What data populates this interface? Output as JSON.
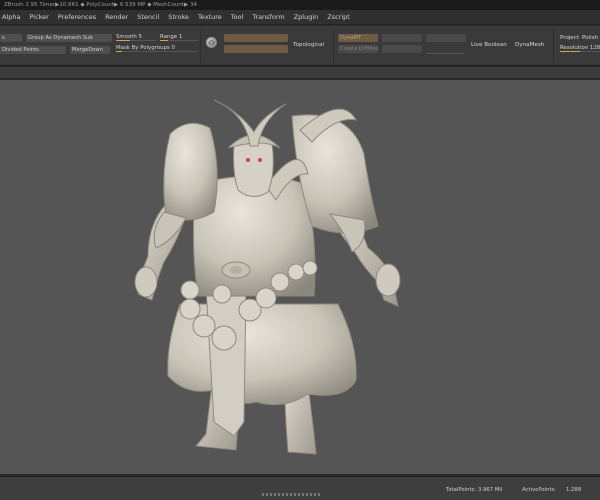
{
  "status_text": "ZBrush 2.95 Timer▶10.661 ◆ PolyCount▶ 6.539 MP ◆ MeshCount▶ 34",
  "menu": [
    "Alpha",
    "Picker",
    "Preferences",
    "Render",
    "Stencil",
    "Stroke",
    "Texture",
    "Tool",
    "Transform",
    "Zplugin",
    "Zscript"
  ],
  "palette": {
    "group_as_dynamesh_sub": "Group As Dynamesh Sub",
    "dynamesh_stub": "s",
    "divided_points": "Divided Points",
    "merge_down": "MergeDown",
    "smooth_label": "Smooth",
    "smooth_value": "5",
    "range_label": "Range",
    "range_value": "1",
    "mask_by_polygroups_label": "Mask By Polygroups",
    "mask_by_polygroups_value": "0",
    "topological": "Topological",
    "dynamat": "DynaMT",
    "create_diffmesh": "Create DiffMesh",
    "live_boolean": "Live Boolean",
    "dynamesh": "DynaMesh",
    "project": "Project",
    "polish": "Polish",
    "resolution_label": "Resolution",
    "resolution_value": "128"
  },
  "bottom": {
    "total_points_label": "TotalPoints:",
    "total_points_value": "3.967 Mil",
    "active_points_label": "ActivePoints:",
    "active_points_value": "1.288"
  }
}
